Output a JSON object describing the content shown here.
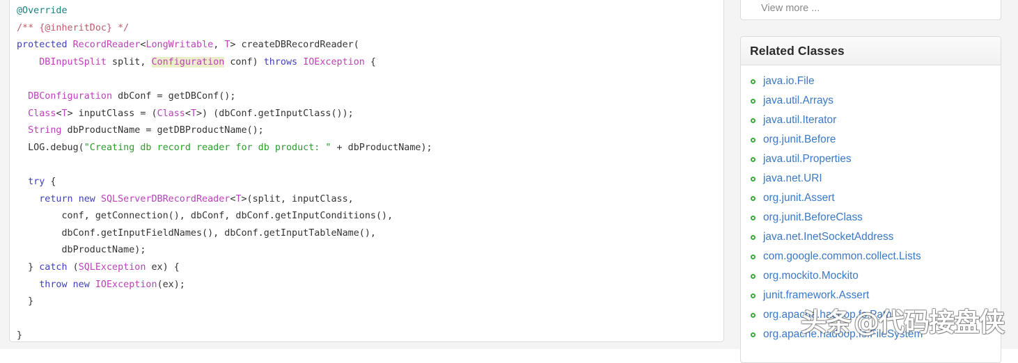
{
  "code_panel": {
    "language": "java",
    "lines": [
      {
        "tokens": [
          {
            "t": "@Override",
            "c": "an"
          }
        ]
      },
      {
        "tokens": [
          {
            "t": "/** {@inheritDoc} */",
            "c": "cm"
          }
        ]
      },
      {
        "tokens": [
          {
            "t": "protected",
            "c": "k"
          },
          {
            "t": " ",
            "c": "p"
          },
          {
            "t": "RecordReader",
            "c": "t"
          },
          {
            "t": "<",
            "c": "p"
          },
          {
            "t": "LongWritable",
            "c": "t"
          },
          {
            "t": ", ",
            "c": "p"
          },
          {
            "t": "T",
            "c": "t"
          },
          {
            "t": "> createDBRecordReader(",
            "c": "p"
          }
        ]
      },
      {
        "tokens": [
          {
            "t": "    ",
            "c": "p"
          },
          {
            "t": "DBInputSplit",
            "c": "t"
          },
          {
            "t": " split, ",
            "c": "p"
          },
          {
            "t": "Configuration",
            "c": "t hl"
          },
          {
            "t": " conf) ",
            "c": "p"
          },
          {
            "t": "throws",
            "c": "k"
          },
          {
            "t": " ",
            "c": "p"
          },
          {
            "t": "IOException",
            "c": "t"
          },
          {
            "t": " {",
            "c": "p"
          }
        ]
      },
      {
        "tokens": []
      },
      {
        "tokens": [
          {
            "t": "  ",
            "c": "p"
          },
          {
            "t": "DBConfiguration",
            "c": "t"
          },
          {
            "t": " dbConf = getDBConf();",
            "c": "p"
          }
        ]
      },
      {
        "tokens": [
          {
            "t": "  ",
            "c": "p"
          },
          {
            "t": "Class",
            "c": "t"
          },
          {
            "t": "<",
            "c": "p"
          },
          {
            "t": "T",
            "c": "t"
          },
          {
            "t": "> inputClass = (",
            "c": "p"
          },
          {
            "t": "Class",
            "c": "t"
          },
          {
            "t": "<",
            "c": "p"
          },
          {
            "t": "T",
            "c": "t"
          },
          {
            "t": ">) (dbConf.getInputClass());",
            "c": "p"
          }
        ]
      },
      {
        "tokens": [
          {
            "t": "  ",
            "c": "p"
          },
          {
            "t": "String",
            "c": "t"
          },
          {
            "t": " dbProductName = getDBProductName();",
            "c": "p"
          }
        ]
      },
      {
        "tokens": [
          {
            "t": "  LOG.debug(",
            "c": "p"
          },
          {
            "t": "\"Creating db record reader for db product: \"",
            "c": "s"
          },
          {
            "t": " + dbProductName);",
            "c": "p"
          }
        ]
      },
      {
        "tokens": []
      },
      {
        "tokens": [
          {
            "t": "  ",
            "c": "p"
          },
          {
            "t": "try",
            "c": "k"
          },
          {
            "t": " {",
            "c": "p"
          }
        ]
      },
      {
        "tokens": [
          {
            "t": "    ",
            "c": "p"
          },
          {
            "t": "return",
            "c": "k"
          },
          {
            "t": " ",
            "c": "p"
          },
          {
            "t": "new",
            "c": "k"
          },
          {
            "t": " ",
            "c": "p"
          },
          {
            "t": "SQLServerDBRecordReader",
            "c": "t"
          },
          {
            "t": "<",
            "c": "p"
          },
          {
            "t": "T",
            "c": "t"
          },
          {
            "t": ">(split, inputClass,",
            "c": "p"
          }
        ]
      },
      {
        "tokens": [
          {
            "t": "        conf, getConnection(), dbConf, dbConf.getInputConditions(),",
            "c": "p"
          }
        ]
      },
      {
        "tokens": [
          {
            "t": "        dbConf.getInputFieldNames(), dbConf.getInputTableName(),",
            "c": "p"
          }
        ]
      },
      {
        "tokens": [
          {
            "t": "        dbProductName);",
            "c": "p"
          }
        ]
      },
      {
        "tokens": [
          {
            "t": "  } ",
            "c": "p"
          },
          {
            "t": "catch",
            "c": "k"
          },
          {
            "t": " (",
            "c": "p"
          },
          {
            "t": "SQLException",
            "c": "t"
          },
          {
            "t": " ex) {",
            "c": "p"
          }
        ]
      },
      {
        "tokens": [
          {
            "t": "    ",
            "c": "p"
          },
          {
            "t": "throw",
            "c": "k"
          },
          {
            "t": " ",
            "c": "p"
          },
          {
            "t": "new",
            "c": "k"
          },
          {
            "t": " ",
            "c": "p"
          },
          {
            "t": "IOException",
            "c": "t"
          },
          {
            "t": "(ex);",
            "c": "p"
          }
        ]
      },
      {
        "tokens": [
          {
            "t": "  }",
            "c": "p"
          }
        ]
      },
      {
        "tokens": []
      },
      {
        "tokens": [
          {
            "t": "}",
            "c": "p"
          }
        ]
      }
    ]
  },
  "sidebar": {
    "view_more_panel": {
      "link_label": "View more ..."
    },
    "related_classes": {
      "title": "Related Classes",
      "bullet_color": "#3aa93a",
      "link_color": "#3a78c8",
      "items": [
        "java.io.File",
        "java.util.Arrays",
        "java.util.Iterator",
        "org.junit.Before",
        "java.util.Properties",
        "java.net.URI",
        "org.junit.Assert",
        "org.junit.BeforeClass",
        "java.net.InetSocketAddress",
        "com.google.common.collect.Lists",
        "org.mockito.Mockito",
        "junit.framework.Assert",
        "org.apache.hadoop.fs.Path",
        "org.apache.hadoop.fs.FileSystem"
      ]
    }
  },
  "watermark": {
    "brand": "头条",
    "handle": "@代码接盘侠"
  },
  "colors": {
    "keyword": "#3f3fbf",
    "type": "#bf3fbf",
    "string": "#2a9d2a",
    "annotation": "#1a7f7f",
    "comment": "#c05a6a",
    "highlight_bg": "#ecedc9",
    "page_bg": "#f4f4f4",
    "panel_border": "#dcdcdc"
  }
}
